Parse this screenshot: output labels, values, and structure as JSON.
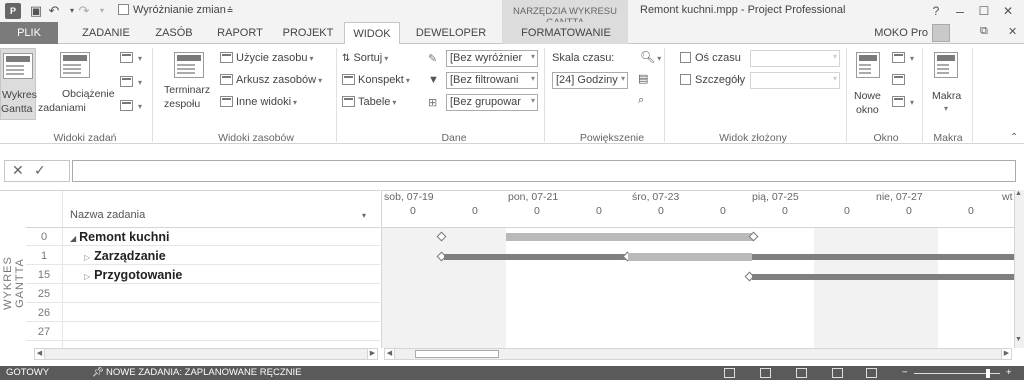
{
  "titlebar": {
    "highlight_changes": "Wyróżnianie zmian",
    "context_tab_group": "NARZĘDZIA WYKRESU GANTTA",
    "title": "Remont kuchni.mpp - Project Professional",
    "help": "?",
    "minimize": "–",
    "restore": "☐",
    "close": "✕",
    "app_badge": "P"
  },
  "tabs": [
    {
      "label": "PLIK"
    },
    {
      "label": "ZADANIE"
    },
    {
      "label": "ZASÓB"
    },
    {
      "label": "RAPORT"
    },
    {
      "label": "PROJEKT"
    },
    {
      "label": "WIDOK"
    },
    {
      "label": "DEWELOPER"
    },
    {
      "label": "FORMATOWANIE"
    }
  ],
  "user": {
    "name": "MOKO Pro"
  },
  "ribbon": {
    "task_views": {
      "label": "Widoki zadań",
      "gantt_chart": [
        "Wykres",
        "Gantta"
      ],
      "task_usage": [
        "Obciążenie",
        "zadaniami"
      ]
    },
    "resource_views": {
      "label": "Widoki zasobów",
      "team_planner": [
        "Terminarz",
        "zespołu"
      ],
      "resource_usage": "Użycie zasobu",
      "resource_sheet": "Arkusz zasobów",
      "other_views": "Inne widoki"
    },
    "data": {
      "label": "Dane",
      "sort": "Sortuj",
      "outline": "Konspekt",
      "tables": "Tabele",
      "highlight": "[Bez wyróżnier",
      "filter": "[Bez filtrowani",
      "group": "[Bez grupowar"
    },
    "zoom": {
      "label": "Powiększenie",
      "timescale_label": "Skala czasu:",
      "timescale_value": "[24] Godziny"
    },
    "split_view": {
      "label": "Widok złożony",
      "timeline": "Oś czasu",
      "details": "Szczegóły"
    },
    "window": {
      "label": "Okno",
      "new_window": [
        "Nowe",
        "okno"
      ]
    },
    "macros": {
      "label": "Makra",
      "macros_button": "Makra"
    }
  },
  "formula": {
    "cancel": "✕",
    "enter": "✓",
    "value": ""
  },
  "grid": {
    "vertical_label": "WYKRES GANTTA",
    "column_header": "Nazwa zadania",
    "rows": [
      {
        "id": "0",
        "name": "Remont kuchni",
        "prefix": "◢"
      },
      {
        "id": "1",
        "name": "Zarządzanie",
        "prefix": "▷"
      },
      {
        "id": "15",
        "name": "Przygotowanie",
        "prefix": "▷"
      },
      {
        "id": "25",
        "name": "",
        "prefix": ""
      },
      {
        "id": "26",
        "name": "",
        "prefix": ""
      },
      {
        "id": "27",
        "name": "",
        "prefix": ""
      }
    ]
  },
  "gantt": {
    "dates": [
      "sob, 07-19",
      "pon, 07-21",
      "śro, 07-23",
      "pią, 07-25",
      "nie, 07-27",
      "wt"
    ],
    "ticks": [
      "0",
      "0",
      "0",
      "0",
      "0",
      "0",
      "0",
      "0",
      "0",
      "0"
    ]
  },
  "status": {
    "ready": "GOTOWY",
    "new_tasks": "NOWE ZADANIA: ZAPLANOWANE RĘCZNIE"
  }
}
